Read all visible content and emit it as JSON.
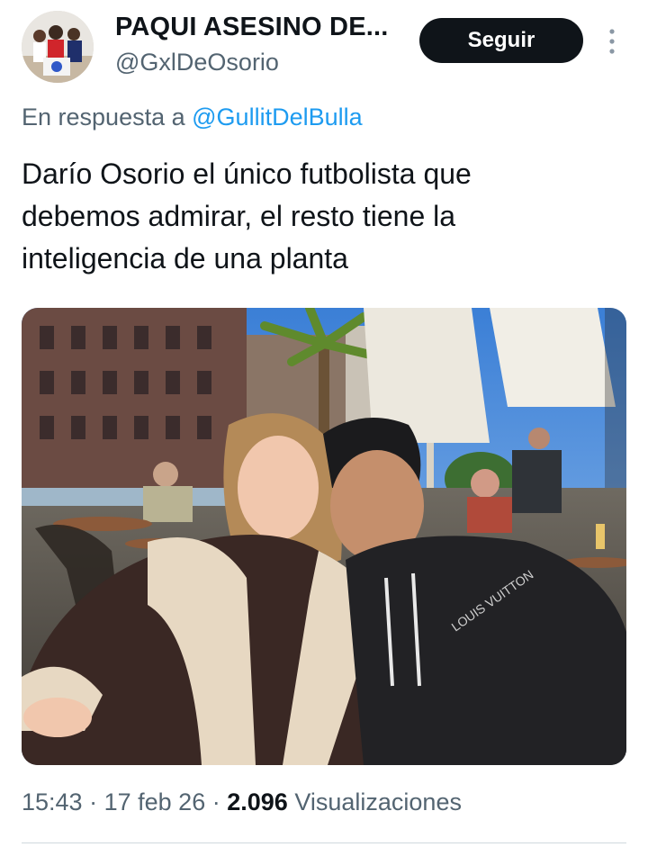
{
  "author": {
    "display_name": "PAQUI ASESINO DE...",
    "handle": "@GxlDeOsorio"
  },
  "follow_button": {
    "label": "Seguir"
  },
  "more_menu": {
    "icon": "more-vertical-icon"
  },
  "reply": {
    "prefix": "En respuesta a",
    "handle": "@GullitDelBulla"
  },
  "tweet": {
    "lines": [
      "Darío Osorio el único futbolista que",
      "debemos admirar, el resto tiene la",
      "inteligencia de una planta"
    ]
  },
  "meta": {
    "time": "15:43",
    "date": "17 feb 26",
    "separator": "·",
    "views_count": "2.096",
    "views_label": "Visualizaciones"
  },
  "colors": {
    "text": "#0f1419",
    "secondary": "#536471",
    "link": "#1d9bf0",
    "button": "#0f1419"
  }
}
